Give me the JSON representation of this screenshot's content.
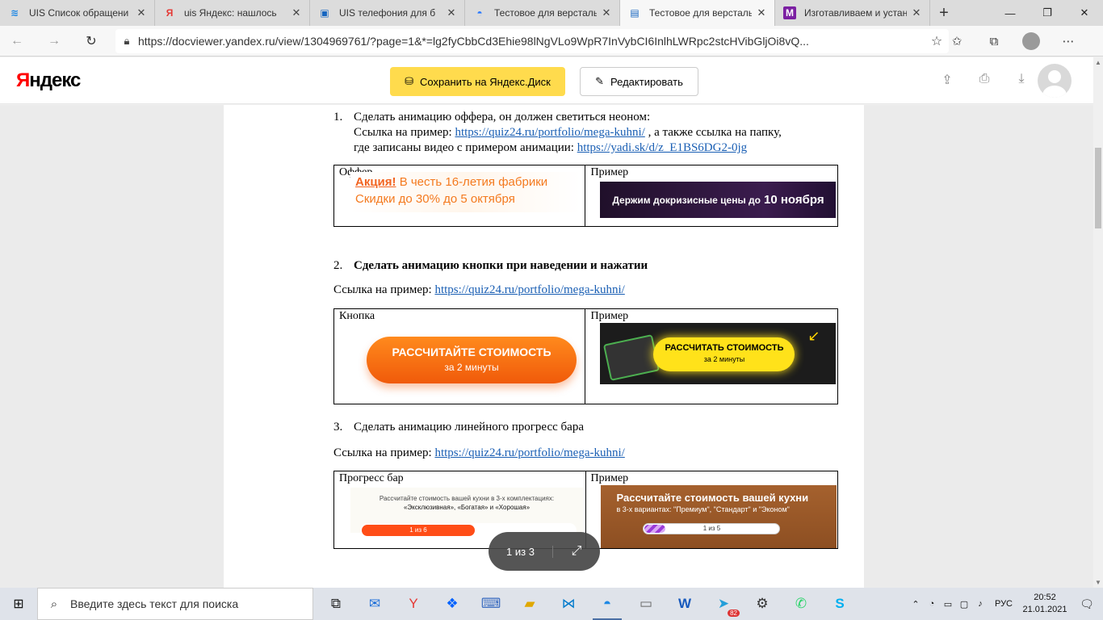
{
  "tabs": [
    {
      "icon": "uis-wifi-icon",
      "title": "UIS   Список обращени",
      "color": "#1e88e5",
      "glyph": "≋"
    },
    {
      "icon": "yandex-icon",
      "title": "uis     Яндекс: нашлось",
      "color": "#e53935",
      "glyph": "Я"
    },
    {
      "icon": "uis-cube-icon",
      "title": "UIS     телефония для б",
      "color": "#1565c0",
      "glyph": "▣"
    },
    {
      "icon": "edge-icon",
      "title": "Тестовое для версталь",
      "color": "#2979ff",
      "glyph": "◓"
    },
    {
      "icon": "doc-icon",
      "title": "Тестовое для версталь",
      "color": "#1565c0",
      "glyph": "▤"
    },
    {
      "icon": "mk-icon",
      "title": "Изготавливаем и устан",
      "color": "#7b1fa2",
      "glyph": "M"
    }
  ],
  "url": "https://docviewer.yandex.ru/view/1304969761/?page=1&*=lg2fyCbbCd3Ehie98lNgVLo9WpR7InVybCI6InlhLWRpc2stcHVibGljOi8vQ...",
  "header": {
    "logo_first": "Я",
    "logo_rest": "ндекс",
    "save_label": "Сохранить на Яндекс.Диск",
    "edit_label": "Редактировать"
  },
  "doc": {
    "item1": {
      "num": "1.",
      "title": "Сделать анимацию оффера, он должен светиться неоном:",
      "line2_pre": "Ссылка на пример: ",
      "line2_link": "https://quiz24.ru/portfolio/mega-kuhni/",
      "line2_post": " , а также ссылка на папку,",
      "line3_pre": "где записаны видео с примером анимации: ",
      "line3_link": "https://yadi.sk/d/z_E1BS6DG2-0jg"
    },
    "table1": {
      "col1": "Оффер",
      "col2": "Пример",
      "offer_bold": "Акция!",
      "offer_rest": " В честь 16-летия фабрики",
      "offer_line2": "Скидки до 30% до 5 октября",
      "example_pre": "Держим докризисные цены до",
      "example_bold": "10 ноября"
    },
    "item2": {
      "num": "2.",
      "title": "Сделать анимацию кнопки при наведении и нажатии",
      "link_pre": "Ссылка на пример: ",
      "link": "https://quiz24.ru/portfolio/mega-kuhni/"
    },
    "table2": {
      "col1": "Кнопка",
      "col2": "Пример",
      "btn_main": "РАССЧИТАЙТЕ СТОИМОСТЬ",
      "btn_sub": "за 2 минуты",
      "ex_main": "РАССЧИТАТЬ СТОИМОСТЬ",
      "ex_sub": "за 2 минуты"
    },
    "item3": {
      "num": "3.",
      "title": "Сделать анимацию линейного прогресс бара",
      "link_pre": "Ссылка на пример:  ",
      "link": "https://quiz24.ru/portfolio/mega-kuhni/"
    },
    "table3": {
      "col1": "Прогресс бар",
      "col2": "Пример",
      "p1_line1": "Рассчитайте стоимость вашей кухни в 3-х комплектациях:",
      "p1_line2": "«Эксклюзивная», «Богатая» и «Хорошая»",
      "p1_bar": "1 из 6",
      "p2_title": "Рассчитайте стоимость вашей кухни",
      "p2_sub": "в 3-х вариантах: \"Премиум\", \"Стандарт\" и \"Эконом\"",
      "p2_bar": "1 из 5"
    }
  },
  "pager": {
    "label": "1 из 3"
  },
  "taskbar": {
    "search_placeholder": "Введите здесь текст для поиска",
    "lang": "РУС",
    "time": "20:52",
    "date": "21.01.2021",
    "telegram_badge": "82"
  }
}
